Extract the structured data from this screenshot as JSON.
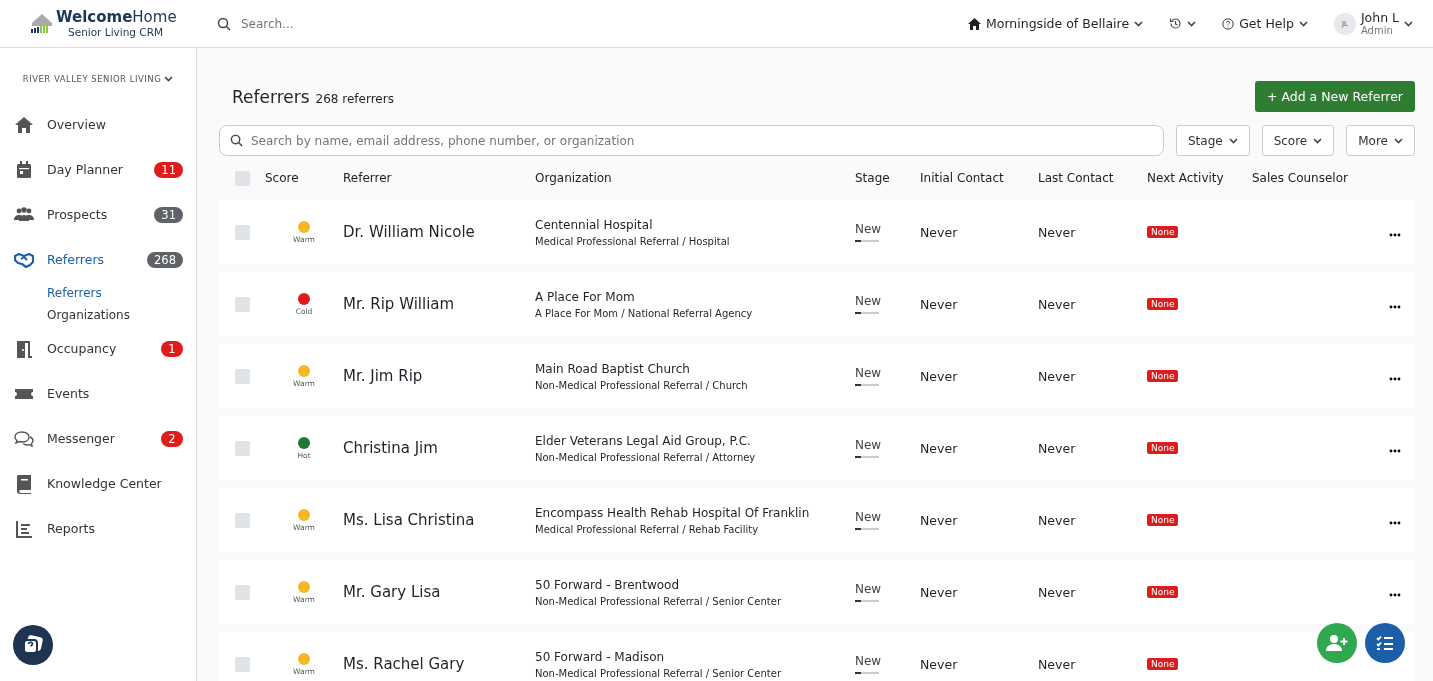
{
  "header": {
    "logo_bold": "Welcome",
    "logo_light": "Home",
    "logo_sub": "Senior Living CRM",
    "search": {
      "placeholder": "Search..."
    },
    "community": "Morningside of Bellaire",
    "help": "Get Help",
    "user": {
      "initials": "JL",
      "name": "John L",
      "role": "Admin"
    }
  },
  "sidebar": {
    "org": "RIVER VALLEY SENIOR LIVING",
    "items": [
      {
        "kind": "home",
        "label": "Overview",
        "selected": false
      },
      {
        "kind": "calendar",
        "label": "Day Planner",
        "selected": false,
        "badge": "11",
        "color": "#e01b1b"
      },
      {
        "kind": "people",
        "label": "Prospects",
        "selected": false,
        "badge": "31",
        "color": "#5f6368"
      },
      {
        "kind": "handshake",
        "label": "Referrers",
        "selected": true,
        "badge": "268",
        "color": "#5f6368",
        "children": [
          {
            "label": "Referrers",
            "selected": true
          },
          {
            "label": "Organizations",
            "selected": false
          }
        ]
      },
      {
        "kind": "door",
        "label": "Occupancy",
        "selected": false,
        "badge": "1",
        "color": "#e01b1b"
      },
      {
        "kind": "ticket",
        "label": "Events",
        "selected": false
      },
      {
        "kind": "chat",
        "label": "Messenger",
        "selected": false,
        "badge": "2",
        "color": "#e01b1b"
      },
      {
        "kind": "book",
        "label": "Knowledge Center",
        "selected": false
      },
      {
        "kind": "chart",
        "label": "Reports",
        "selected": false
      }
    ]
  },
  "page": {
    "title": "Referrers",
    "count": "268 referrers",
    "add_button": "+ Add a New Referrer",
    "search": {
      "placeholder": "Search by name, email address, phone number, or organization"
    },
    "filters": [
      "Stage",
      "Score",
      "More"
    ]
  },
  "table": {
    "select_all_checked": false,
    "columns": [
      "Score",
      "Referrer",
      "Organization",
      "Stage",
      "Initial Contact",
      "Last Contact",
      "Next Activity",
      "Sales Counselor"
    ],
    "rows": [
      {
        "checked": false,
        "score": "Warm",
        "color": "#f2b824",
        "referrer": "Dr. William Nicole",
        "organization": "Centennial Hospital",
        "org_type": "Medical Professional Referral / Hospital",
        "stage": "New",
        "level": 0.25,
        "initial_contact": "Never",
        "last_contact": "Never",
        "next_activity": "None"
      },
      {
        "checked": false,
        "score": "Cold",
        "color": "#e01b1b",
        "referrer": "Mr. Rip William",
        "organization": "A Place For Mom",
        "org_type": "A Place For Mom / National Referral Agency",
        "stage": "New",
        "level": 0.25,
        "initial_contact": "Never",
        "last_contact": "Never",
        "next_activity": "None"
      },
      {
        "checked": false,
        "score": "Warm",
        "color": "#f2b824",
        "referrer": "Mr. Jim Rip",
        "organization": "Main Road Baptist Church",
        "org_type": "Non-Medical Professional Referral / Church",
        "stage": "New",
        "level": 0.25,
        "initial_contact": "Never",
        "last_contact": "Never",
        "next_activity": "None"
      },
      {
        "checked": false,
        "score": "Hot",
        "color": "#1f7a32",
        "referrer": "Christina Jim",
        "organization": "Elder Veterans Legal Aid Group, P.C.",
        "org_type": "Non-Medical Professional Referral / Attorney",
        "stage": "New",
        "level": 0.25,
        "initial_contact": "Never",
        "last_contact": "Never",
        "next_activity": "None"
      },
      {
        "checked": false,
        "score": "Warm",
        "color": "#f2b824",
        "referrer": "Ms. Lisa Christina",
        "organization": "Encompass Health Rehab Hospital Of Franklin",
        "org_type": "Medical Professional Referral / Rehab Facility",
        "stage": "New",
        "level": 0.25,
        "initial_contact": "Never",
        "last_contact": "Never",
        "next_activity": "None"
      },
      {
        "checked": false,
        "score": "Warm",
        "color": "#f2b824",
        "referrer": "Mr. Gary Lisa",
        "organization": "50 Forward - Brentwood",
        "org_type": "Non-Medical Professional Referral / Senior Center",
        "stage": "New",
        "level": 0.25,
        "initial_contact": "Never",
        "last_contact": "Never",
        "next_activity": "None"
      },
      {
        "checked": false,
        "score": "Warm",
        "color": "#f2b824",
        "referrer": "Ms. Rachel Gary",
        "organization": "50 Forward - Madison",
        "org_type": "Non-Medical Professional Referral / Senior Center",
        "stage": "New",
        "level": 0.25,
        "initial_contact": "Never",
        "last_contact": "Never",
        "next_activity": "None",
        "menu": false
      }
    ]
  }
}
